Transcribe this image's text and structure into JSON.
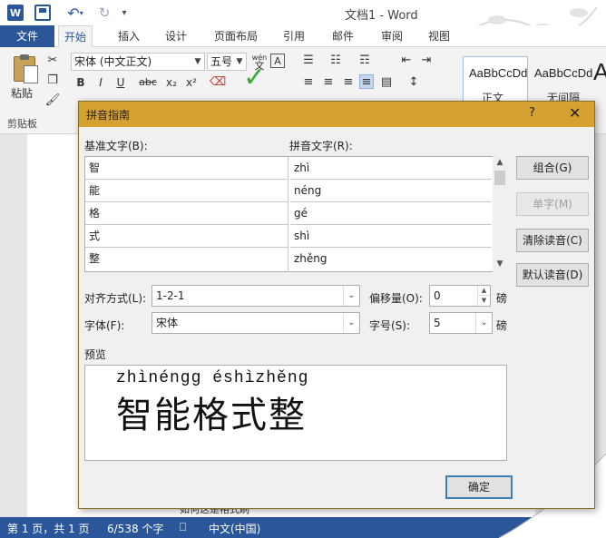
{
  "window": {
    "title": "文档1 - Word",
    "qat": {
      "word_logo": "W"
    }
  },
  "ribbon_tabs": [
    "文件",
    "开始",
    "插入",
    "设计",
    "页面布局",
    "引用",
    "邮件",
    "审阅",
    "视图"
  ],
  "ribbon": {
    "paste_label": "粘贴",
    "clipboard_group": "剪贴板",
    "font_name": "宋体 (中文正文)",
    "font_size": "五号",
    "wen_label": "wén",
    "wen_char": "文",
    "A_label": "A",
    "fmt_buttons": [
      "B",
      "I",
      "U",
      "abc",
      "x₂",
      "x²"
    ],
    "styles": [
      {
        "preview": "AaBbCcDd",
        "name": "正文"
      },
      {
        "preview": "AaBbCcDd",
        "name": "无间隔"
      }
    ],
    "big_a": "A",
    "check": "✓"
  },
  "dialog": {
    "title": "拼音指南",
    "help": "?",
    "close": "✕",
    "base_text_label": "基准文字(B):",
    "pinyin_text_label": "拼音文字(R):",
    "rows": [
      {
        "base": "智",
        "pinyin": "zhì"
      },
      {
        "base": "能",
        "pinyin": "néng"
      },
      {
        "base": "格",
        "pinyin": "gé"
      },
      {
        "base": "式",
        "pinyin": "shì"
      },
      {
        "base": "整",
        "pinyin": "zhěng"
      }
    ],
    "buttons": {
      "group": "组合(G)",
      "single": "单字(M)",
      "clear": "清除读音(C)",
      "default": "默认读音(D)",
      "ok": "确定"
    },
    "alignment_label": "对齐方式(L):",
    "alignment_value": "1-2-1",
    "offset_label": "偏移量(O):",
    "offset_value": "0",
    "offset_unit": "磅",
    "font_label": "字体(F):",
    "font_value": "宋体",
    "size_label": "字号(S):",
    "size_value": "5",
    "size_unit": "磅",
    "preview_label": "预览",
    "preview_pinyin": "zhìnéngg éshìzhěng",
    "preview_hanzi": "智能格式整"
  },
  "doc": {
    "partial_line": "如何这是格式刷"
  },
  "status": {
    "page": "第 1 页，共 1 页",
    "words": "6/538 个字",
    "macro": "⎕",
    "lang": "中文(中国)"
  },
  "colors": {
    "brand": "#2b579a",
    "dialog_title": "#d5a231",
    "ok_border": "#3c7fb1"
  }
}
